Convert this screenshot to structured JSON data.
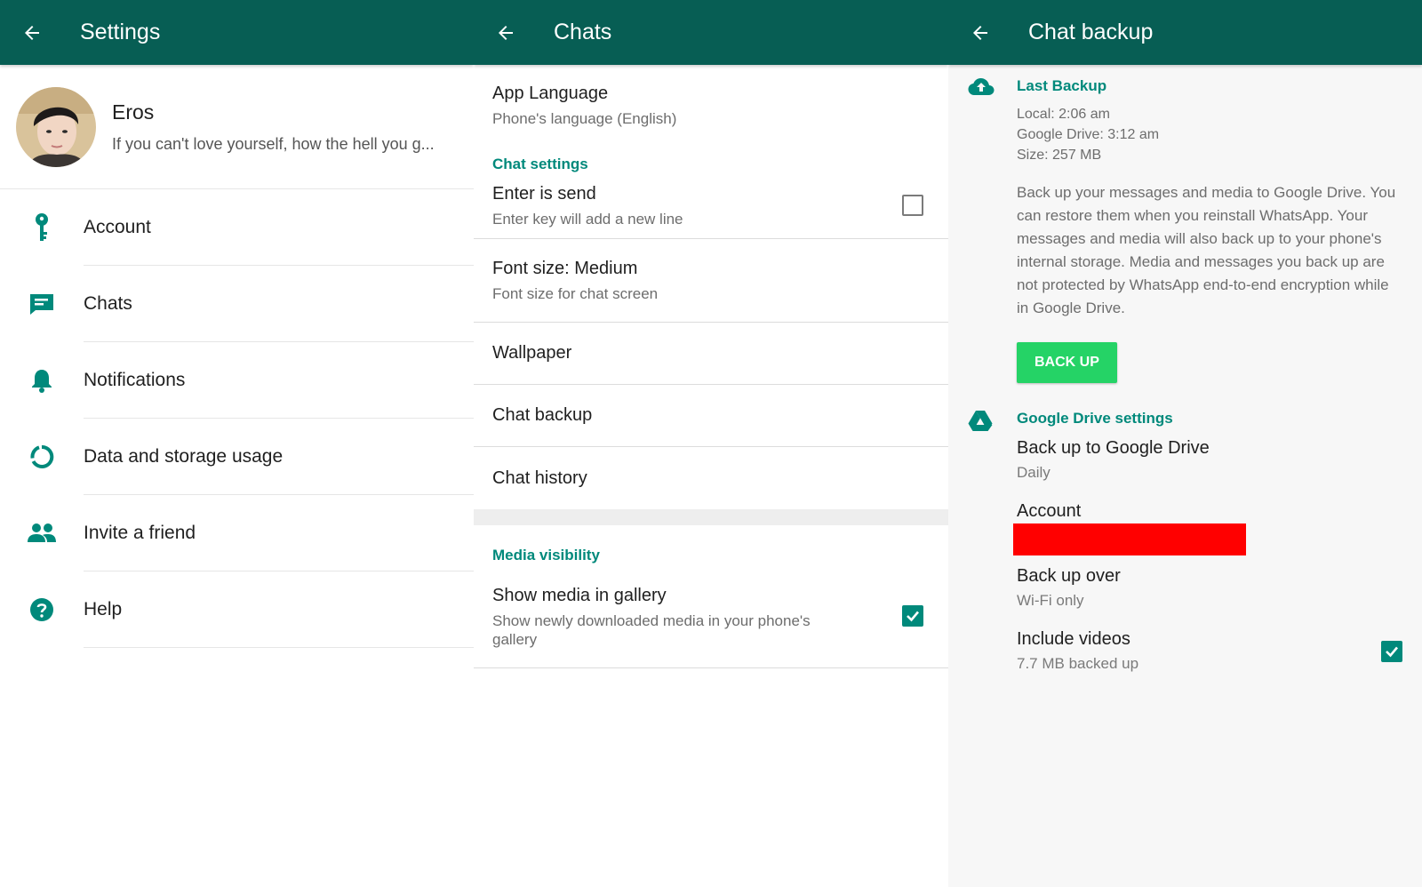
{
  "settings_screen": {
    "title": "Settings",
    "profile": {
      "name": "Eros",
      "status": "If you can't love yourself, how the hell you g..."
    },
    "menu": [
      {
        "label": "Account",
        "icon": "key-icon"
      },
      {
        "label": "Chats",
        "icon": "chat-icon"
      },
      {
        "label": "Notifications",
        "icon": "bell-icon"
      },
      {
        "label": "Data and storage usage",
        "icon": "data-usage-icon"
      },
      {
        "label": "Invite a friend",
        "icon": "people-icon"
      },
      {
        "label": "Help",
        "icon": "help-icon"
      }
    ]
  },
  "chats_screen": {
    "title": "Chats",
    "app_language": {
      "title": "App Language",
      "subtitle": "Phone's language (English)"
    },
    "chat_settings_header": "Chat settings",
    "enter_is_send": {
      "title": "Enter is send",
      "subtitle": "Enter key will add a new line",
      "checked": false
    },
    "font_size": {
      "title": "Font size: Medium",
      "subtitle": "Font size for chat screen"
    },
    "wallpaper": {
      "title": "Wallpaper"
    },
    "chat_backup": {
      "title": "Chat backup"
    },
    "chat_history": {
      "title": "Chat history"
    },
    "media_visibility_header": "Media visibility",
    "show_media": {
      "title": "Show media in gallery",
      "subtitle": "Show newly downloaded media in your phone's gallery",
      "checked": true
    }
  },
  "backup_screen": {
    "title": "Chat backup",
    "last_backup": {
      "header": "Last Backup",
      "local": "Local: 2:06 am",
      "google_drive": "Google Drive: 3:12 am",
      "size": "Size: 257 MB",
      "description": "Back up your messages and media to Google Drive. You can restore them when you reinstall WhatsApp. Your messages and media will also back up to your phone's internal storage. Media and messages you back up are not protected by WhatsApp end-to-end encryption while in Google Drive.",
      "button": "BACK UP"
    },
    "drive_settings": {
      "header": "Google Drive settings",
      "backup_to_drive": {
        "title": "Back up to Google Drive",
        "subtitle": "Daily"
      },
      "account": {
        "title": "Account"
      },
      "backup_over": {
        "title": "Back up over",
        "subtitle": "Wi-Fi only"
      },
      "include_videos": {
        "title": "Include videos",
        "subtitle": "7.7 MB backed up",
        "checked": true
      }
    }
  },
  "colors": {
    "appbar": "#075e54",
    "accent": "#00897b",
    "button": "#25d366",
    "redaction": "#ff0000"
  }
}
